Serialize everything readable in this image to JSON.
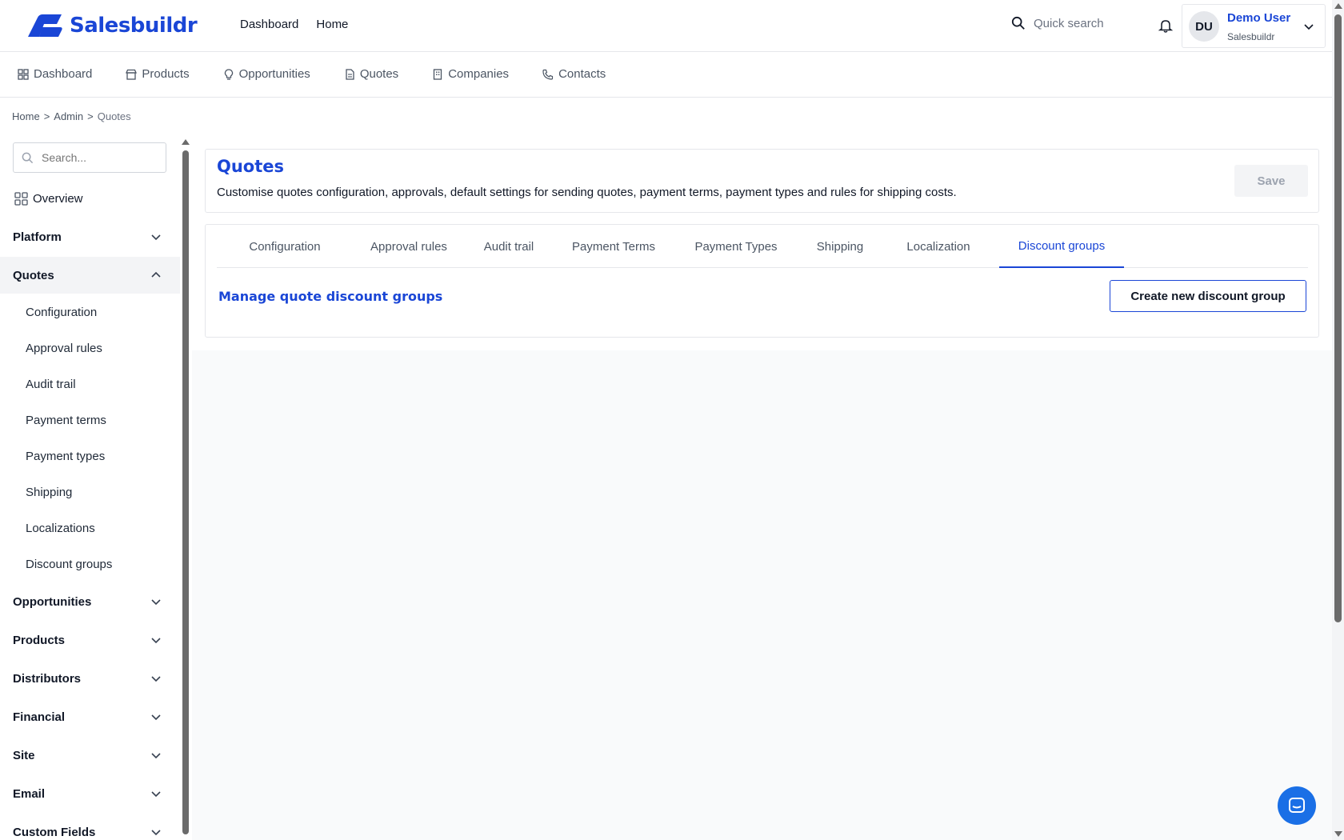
{
  "brand": {
    "name": "Salesbuildr",
    "color": "#1a46d6"
  },
  "top_nav": [
    {
      "label": "Dashboard"
    },
    {
      "label": "Home"
    }
  ],
  "quick_search": {
    "placeholder": "Quick search"
  },
  "user": {
    "initials": "DU",
    "name": "Demo User",
    "org": "Salesbuildr"
  },
  "module_nav": [
    {
      "label": "Dashboard",
      "icon": "grid-icon"
    },
    {
      "label": "Products",
      "icon": "store-icon"
    },
    {
      "label": "Opportunities",
      "icon": "lightbulb-icon"
    },
    {
      "label": "Quotes",
      "icon": "document-icon"
    },
    {
      "label": "Companies",
      "icon": "building-icon"
    },
    {
      "label": "Contacts",
      "icon": "phone-icon"
    }
  ],
  "breadcrumb": {
    "home": "Home",
    "admin": "Admin",
    "current": "Quotes",
    "sep": ">"
  },
  "sidebar": {
    "search_placeholder": "Search...",
    "overview": "Overview",
    "sections": [
      {
        "label": "Platform",
        "open": false
      },
      {
        "label": "Quotes",
        "open": true
      },
      {
        "label": "Opportunities",
        "open": false
      },
      {
        "label": "Products",
        "open": false
      },
      {
        "label": "Distributors",
        "open": false
      },
      {
        "label": "Financial",
        "open": false
      },
      {
        "label": "Site",
        "open": false
      },
      {
        "label": "Email",
        "open": false
      },
      {
        "label": "Custom Fields",
        "open": false
      }
    ],
    "quotes_items": [
      "Configuration",
      "Approval rules",
      "Audit trail",
      "Payment terms",
      "Payment types",
      "Shipping",
      "Localizations",
      "Discount groups"
    ]
  },
  "header_card": {
    "title": "Quotes",
    "description": "Customise quotes configuration, approvals, default settings for sending quotes, payment terms, payment types and rules for shipping costs.",
    "save_label": "Save"
  },
  "tabs": [
    {
      "label": "Configuration"
    },
    {
      "label": "Approval rules"
    },
    {
      "label": "Audit trail"
    },
    {
      "label": "Payment Terms"
    },
    {
      "label": "Payment Types"
    },
    {
      "label": "Shipping"
    },
    {
      "label": "Localization"
    },
    {
      "label": "Discount groups",
      "active": true
    }
  ],
  "discount_groups": {
    "heading": "Manage quote discount groups",
    "create_label": "Create new discount group"
  }
}
